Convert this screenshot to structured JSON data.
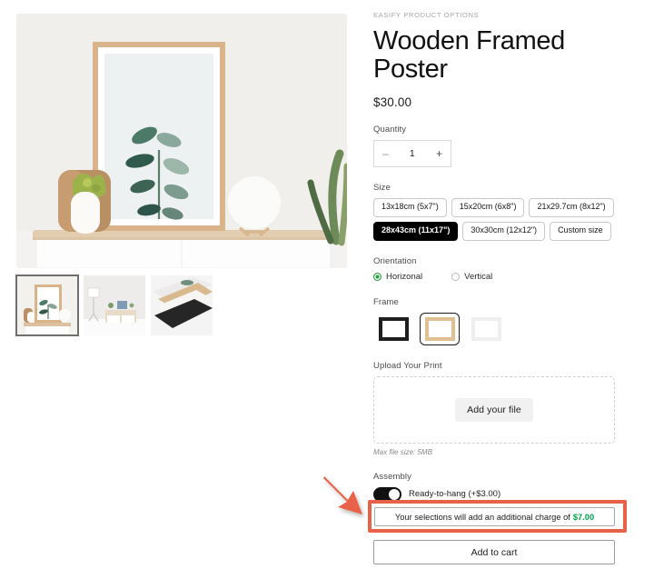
{
  "product": {
    "eyebrow": "EASIFY PRODUCT OPTIONS",
    "title": "Wooden Framed Poster",
    "price": "$30.00"
  },
  "gallery": {
    "thumbnails": [
      {
        "name": "poster-on-sideboard",
        "selected": true
      },
      {
        "name": "living-room-scene",
        "selected": false
      },
      {
        "name": "stacked-frames-detail",
        "selected": false
      }
    ]
  },
  "quantity": {
    "label": "Quantity",
    "decrement": "–",
    "value": "1",
    "increment": "+"
  },
  "size": {
    "label": "Size",
    "options": [
      {
        "label": "13x18cm (5x7\")",
        "selected": false
      },
      {
        "label": "15x20cm (6x8\")",
        "selected": false
      },
      {
        "label": "21x29.7cm (8x12\")",
        "selected": false
      },
      {
        "label": "28x43cm (11x17\")",
        "selected": true
      },
      {
        "label": "30x30cm (12x12\")",
        "selected": false
      },
      {
        "label": "Custom size",
        "selected": false
      }
    ]
  },
  "orientation": {
    "label": "Orientation",
    "options": [
      {
        "label": "Horizonal",
        "selected": true
      },
      {
        "label": "Vertical",
        "selected": false
      }
    ]
  },
  "frame": {
    "label": "Frame",
    "options": [
      {
        "name": "black-frame",
        "color": "#1f1f1f",
        "selected": false
      },
      {
        "name": "wood-frame",
        "color": "#e0bf92",
        "selected": true
      },
      {
        "name": "white-frame",
        "color": "#efefef",
        "selected": false
      }
    ]
  },
  "upload": {
    "label": "Upload Your Print",
    "button": "Add your file",
    "hint": "Max file size: 5MB"
  },
  "assembly": {
    "label": "Assembly",
    "option_label": "Ready-to-hang (+$3.00)",
    "enabled": true
  },
  "notice": {
    "text": "Your selections will add an additional charge of",
    "amount": "$7.00"
  },
  "cart": {
    "label": "Add to cart"
  },
  "annotation": {
    "arrow_color": "#e8624a",
    "box_color": "#e8624a"
  },
  "colors": {
    "accent_green": "#00a44d",
    "radio_green": "#21a03a",
    "selected_chip": "#000000"
  }
}
